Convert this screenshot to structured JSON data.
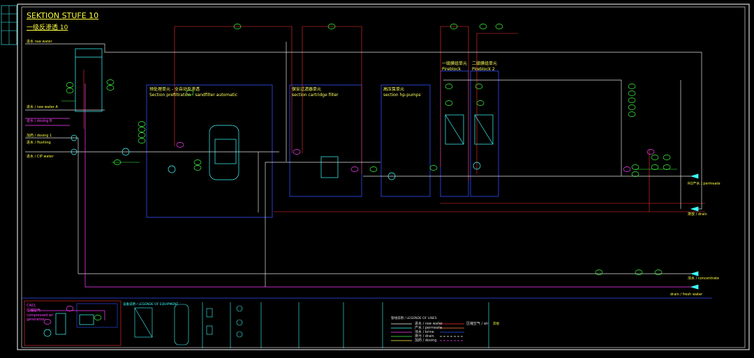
{
  "colors": {
    "background": "#000000",
    "frame": "#ffffff",
    "product_line": "#ffffff",
    "drain_line": "#ff40ff",
    "section_box": "#3050ff",
    "signal_line": "#ff3030",
    "instrument": "#40ff40",
    "label_yellow": "#ffff40",
    "label_cyan": "#40ffff"
  },
  "title": {
    "main": "SEKTION STUFE 10",
    "sub": "一级反渗透  10"
  },
  "sections": {
    "pre": {
      "cn": "预处理单元 - 全自动反渗透",
      "en": "Section prefiltration - sandfilter automatic"
    },
    "cartridge": {
      "cn": "保安过滤器单元",
      "en": "section cartridge filter"
    },
    "hp": {
      "cn": "高压泵单元",
      "en": "section hp-pumps"
    },
    "ro1": {
      "cn": "一级膜组单元",
      "en": "Pireblock"
    },
    "ro2": {
      "cn": "二级膜组单元",
      "en": "Pireblock 2"
    }
  },
  "compressed_air": {
    "tag": "CA01",
    "cn": "压缩空气",
    "en1": "compressed air",
    "en2": "generation"
  },
  "legend": {
    "equipment_title": "设备说明 / LEGENDE OF EQUIPMENT",
    "lines_title": "管线说明 / LEGENDE OF LINES",
    "others_title": "其他",
    "line_items": [
      "进水 / raw water",
      "产水 / permeate",
      "浓水 / brine",
      "排污 / drain",
      "加药 / dosing",
      "压缩空气 / air"
    ]
  },
  "outlets": {
    "o1": "RO产水 / permeate",
    "o2": "排放 / drain",
    "o3": "浓水 / concentrate",
    "o4": "drain / fresh water"
  },
  "inlets": [
    "进水 raw water",
    "进水 / raw water A",
    "进水 / dosing B",
    "加药 / dosing 1",
    "进水 / flushing",
    "进水 / CIP water"
  ]
}
